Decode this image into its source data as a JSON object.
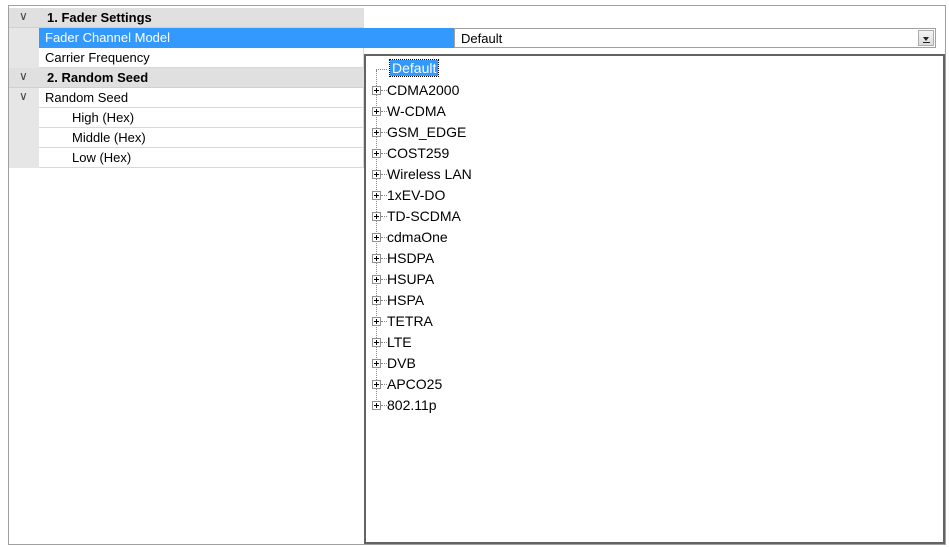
{
  "sections": [
    {
      "label": "1. Fader Settings"
    },
    {
      "label": "2. Random Seed"
    }
  ],
  "fader": {
    "channel_model_label": "Fader Channel Model",
    "channel_model_value": "Default",
    "carrier_frequency_label": "Carrier Frequency"
  },
  "seed": {
    "group_label": "Random Seed",
    "high_label": "High (Hex)",
    "middle_label": "Middle (Hex)",
    "low_label": "Low (Hex)"
  },
  "tree": {
    "default_label": "Default",
    "items": [
      "CDMA2000",
      "W-CDMA",
      "GSM_EDGE",
      "COST259",
      "Wireless LAN",
      "1xEV-DO",
      "TD-SCDMA",
      "cdmaOne",
      "HSDPA",
      "HSUPA",
      "HSPA",
      "TETRA",
      "LTE",
      "DVB",
      "APCO25",
      "802.11p"
    ]
  },
  "colors": {
    "selection": "#3399ff",
    "section_bg": "#e0e0e0"
  },
  "icons": {
    "collapse": "chevron-down-icon",
    "expand": "plus-box-icon",
    "dropdown": "dropdown-arrow-icon"
  }
}
